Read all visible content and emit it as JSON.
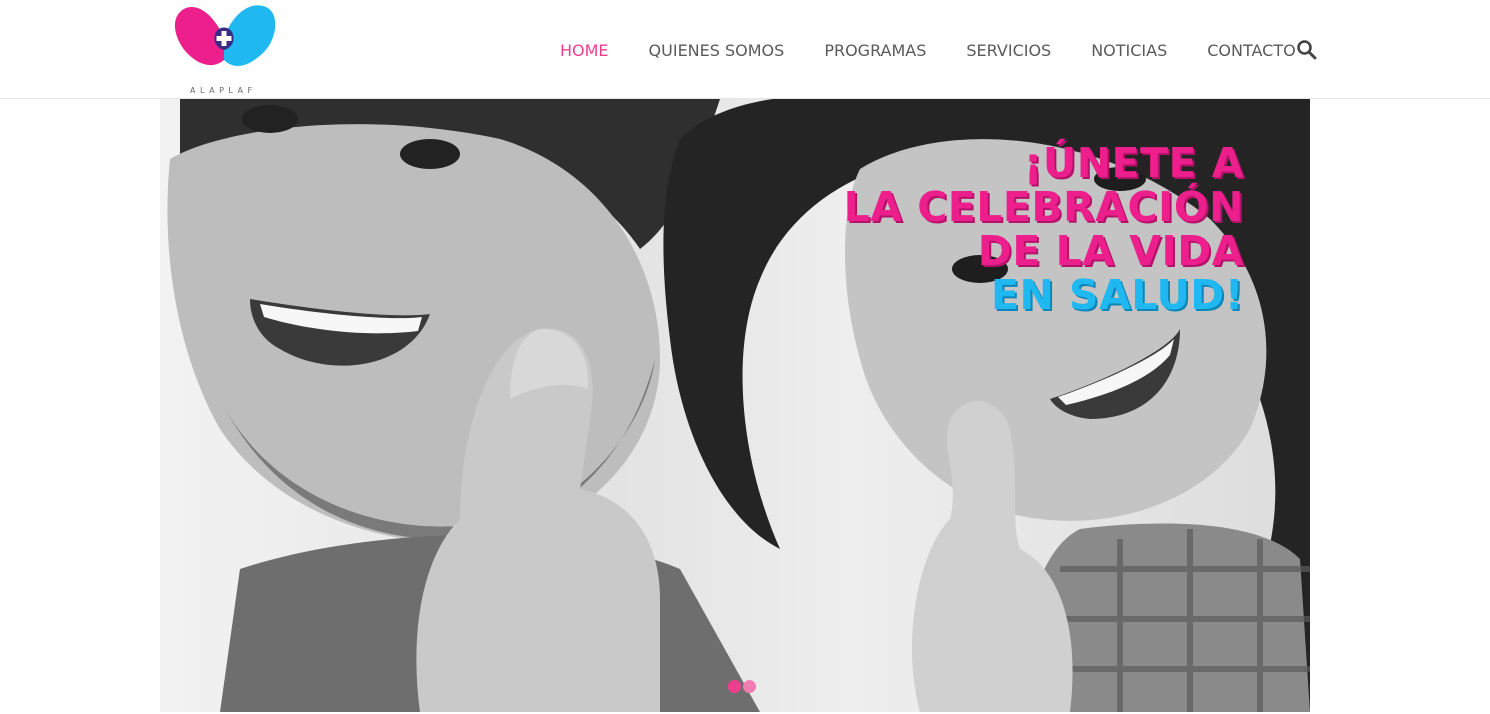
{
  "brand": {
    "logo_text": "ALAPLAF",
    "colors": {
      "pink": "#ec1f8d",
      "blue": "#1fb8f0",
      "nav_active": "#ee3f8e"
    }
  },
  "nav": {
    "items": [
      {
        "label": "HOME",
        "active": true
      },
      {
        "label": "QUIENES SOMOS",
        "active": false
      },
      {
        "label": "PROGRAMAS",
        "active": false
      },
      {
        "label": "SERVICIOS",
        "active": false
      },
      {
        "label": "NOTICIAS",
        "active": false
      },
      {
        "label": "CONTACTO",
        "active": false
      }
    ],
    "search_icon": "search-icon"
  },
  "hero": {
    "headline": {
      "line1": "¡ÚNETE A",
      "line2": "LA CELEBRACIÓN",
      "line3": "DE LA VIDA",
      "line4": "EN SALUD!"
    },
    "slider": {
      "slide_count": 2,
      "active_index": 0
    }
  }
}
